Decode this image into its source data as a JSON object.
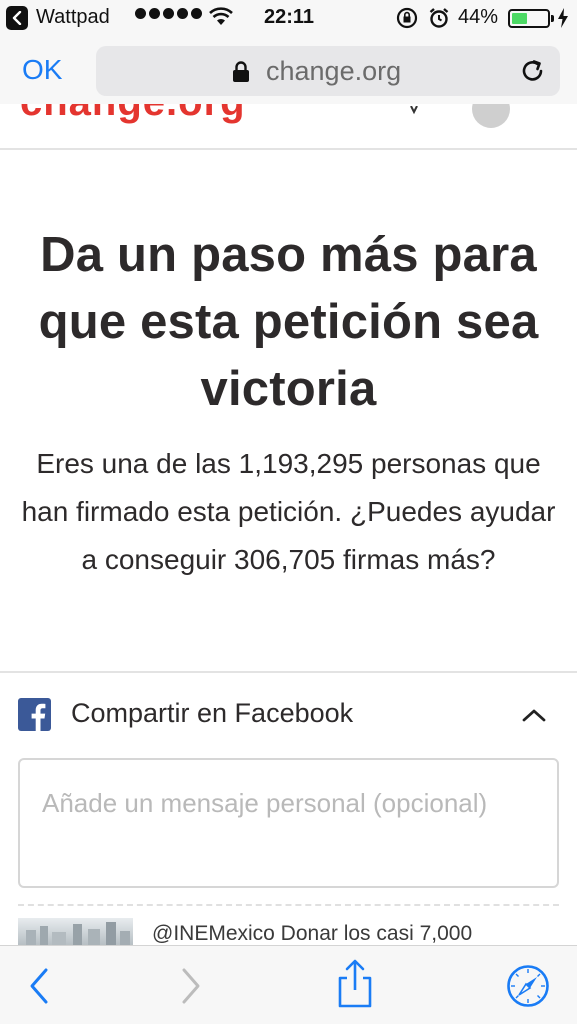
{
  "status_bar": {
    "app_name": "Wattpad",
    "time": "22:11",
    "battery_percent": "44%",
    "battery_level": 0.44,
    "battery_color": "#4cd964",
    "signal_dots": 5
  },
  "browser": {
    "ok_label": "OK",
    "url": "change.org",
    "accent_color": "#1a7cf5"
  },
  "site": {
    "logo_text": "change.org",
    "brand_color": "#e4352f"
  },
  "main": {
    "headline": "Da un paso más para que esta petición sea victoria",
    "subtext": "Eres una de las 1,193,295 personas que han firmado esta petición. ¿Puedes ayudar a conseguir 306,705 firmas más?"
  },
  "share": {
    "label": "Compartir en Facebook",
    "facebook_color": "#3b5998",
    "message_placeholder": "Añade un mensaje personal (opcional)",
    "message_value": "",
    "preview_text": "@INEMexico Donar los casi 7,000"
  },
  "icons": {
    "back": "back-arrow-icon",
    "forward": "forward-arrow-icon",
    "share": "share-icon",
    "safari": "compass-icon",
    "lock": "lock-icon",
    "reload": "reload-icon",
    "facebook": "facebook-icon",
    "collapse": "chevron-up-icon"
  }
}
